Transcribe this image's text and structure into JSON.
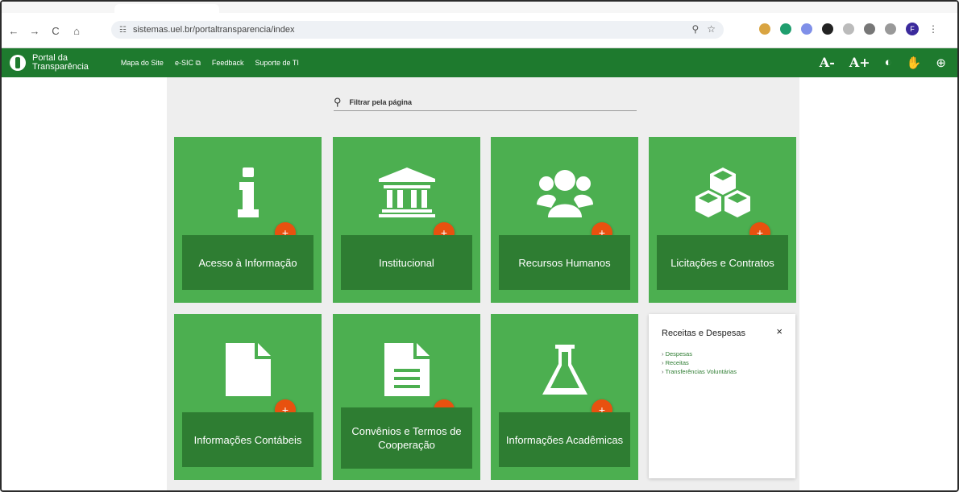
{
  "browser": {
    "url": "sistemas.uel.br/portaltransparencia/index",
    "nav_back": "←",
    "nav_forward": "→",
    "nav_reload": "C",
    "nav_home": "⌂",
    "profile_initial": "F"
  },
  "header": {
    "logo_line1": "Portal da",
    "logo_line2": "Transparência",
    "nav": [
      "Mapa do Site",
      "e-SIC",
      "Feedback",
      "Suporte de TI"
    ],
    "font_decrease": "A-",
    "font_increase": "A+"
  },
  "search": {
    "placeholder": "Filtrar pela página"
  },
  "cards": [
    {
      "label": "Acesso à Informação",
      "icon": "info-icon"
    },
    {
      "label": "Institucional",
      "icon": "bank-icon"
    },
    {
      "label": "Recursos Humanos",
      "icon": "users-icon"
    },
    {
      "label": "Licitações e Contratos",
      "icon": "cubes-icon"
    },
    {
      "label": "Informações Contábeis",
      "icon": "file-icon"
    },
    {
      "label": "Convênios e Termos de Cooperação",
      "icon": "document-icon"
    },
    {
      "label": "Informações Acadêmicas",
      "icon": "flask-icon"
    }
  ],
  "popup": {
    "title": "Receitas e Despesas",
    "close": "×",
    "links": [
      "Despesas",
      "Receitas",
      "Transferências Voluntárias"
    ]
  },
  "plus_label": "+",
  "colors": {
    "header_green": "#1e7a2e",
    "card_green": "#4caf50",
    "label_green": "#2e7d32",
    "plus_orange": "#e8510f"
  }
}
